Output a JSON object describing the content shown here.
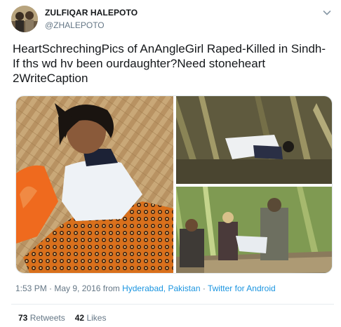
{
  "author": {
    "name": "ZULFIQAR HALEPOTO",
    "handle": "@ZHALEPOTO"
  },
  "tweet": {
    "text": "HeartSchrechingPics of AnAngleGirl Raped-Killed in Sindh-If ths wd hv been ourdaughter?Need stoneheart 2WriteCaption"
  },
  "meta": {
    "time": "1:53 PM",
    "separator1": " · ",
    "date": "May 9, 2016",
    "from_label": " from ",
    "location": "Hyderabad, Pakistan",
    "separator2": " · ",
    "client": "Twitter for Android"
  },
  "stats": {
    "retweets_count": "73",
    "retweets_label": "Retweets",
    "likes_count": "42",
    "likes_label": "Likes"
  },
  "icons": {
    "caret": "chevron-down-icon"
  },
  "colors": {
    "link": "#1b95e0",
    "secondary_text": "#657786",
    "primary_text": "#14171a"
  }
}
